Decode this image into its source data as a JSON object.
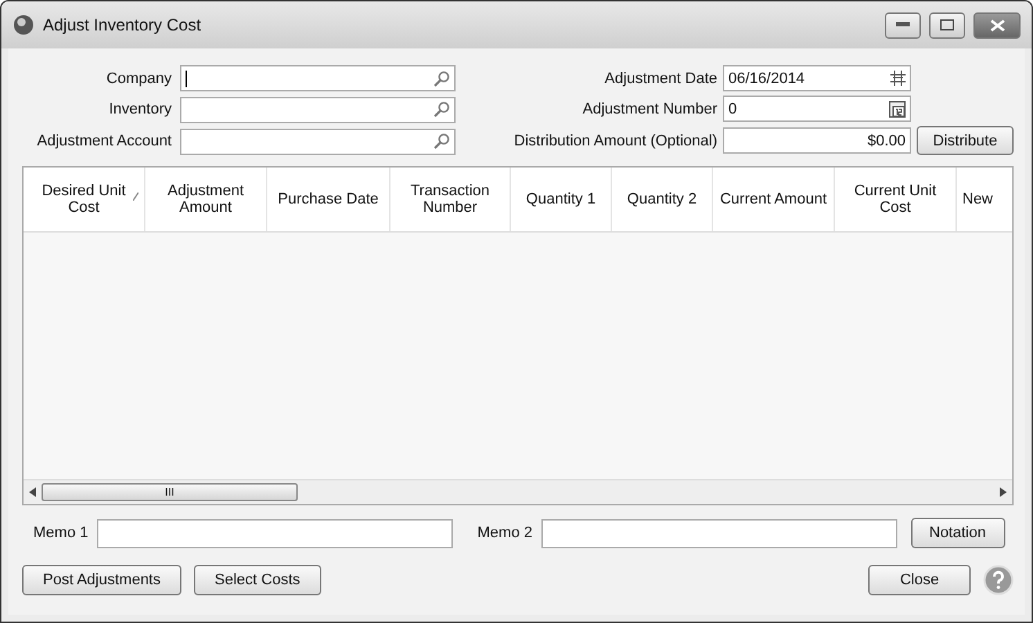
{
  "window": {
    "title": "Adjust Inventory Cost"
  },
  "left_fields": [
    {
      "label": "Company",
      "kind": "lookup",
      "focused": true
    },
    {
      "label": "Inventory",
      "kind": "lookup",
      "focused": false
    },
    {
      "label": "Adjustment Account",
      "kind": "lookup",
      "focused": false
    }
  ],
  "right_fields": [
    {
      "label": "Adjustment Date",
      "kind": "date",
      "value": "06/16/2014"
    },
    {
      "label": "Adjustment Number",
      "kind": "number",
      "value": "0"
    },
    {
      "label": "Distribution Amount (Optional)",
      "kind": "amount",
      "value": "$0.00"
    }
  ],
  "distribute_button": "Distribute",
  "table": {
    "columns": [
      {
        "label": "Desired Unit Cost",
        "sorted": true
      },
      {
        "label": "Adjustment Amount",
        "sorted": false
      },
      {
        "label": "Purchase Date",
        "sorted": false
      },
      {
        "label": "Transaction Number",
        "sorted": false
      },
      {
        "label": "Quantity 1",
        "sorted": false
      },
      {
        "label": "Quantity 2",
        "sorted": false
      },
      {
        "label": "Current Amount",
        "sorted": false
      },
      {
        "label": "Current Unit Cost",
        "sorted": false
      },
      {
        "label": "New",
        "sorted": false
      }
    ],
    "scroll_thumb": "III"
  },
  "memo_1": {
    "label": "Memo 1"
  },
  "memo_2": {
    "label": "Memo 2"
  },
  "notation_button": "Notation",
  "buttons": [
    "Post Adjustments",
    "Select Costs"
  ],
  "close_button": "Close"
}
